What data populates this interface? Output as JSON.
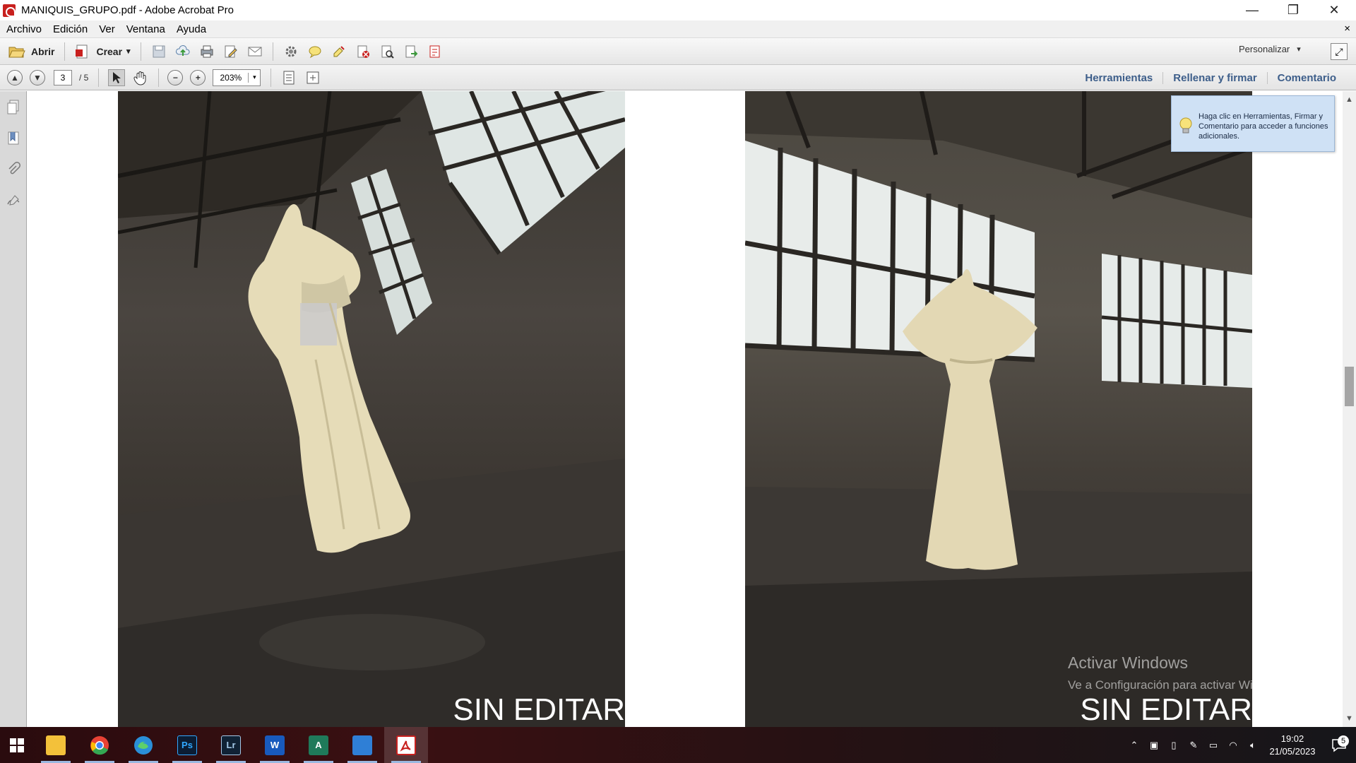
{
  "window": {
    "title": "MANIQUIS_GRUPO.pdf - Adobe Acrobat Pro",
    "minimize_glyph": "—",
    "restore_glyph": "❐",
    "close_glyph": "✕"
  },
  "menubar": {
    "items": [
      "Archivo",
      "Edición",
      "Ver",
      "Ventana",
      "Ayuda"
    ],
    "close_glyph": "×"
  },
  "toolbar": {
    "open_label": "Abrir",
    "create_label": "Crear",
    "customize_label": "Personalizar",
    "dropdown_glyph": "▾"
  },
  "navigation": {
    "current_page": "3",
    "total_pages": "/ 5",
    "zoom": "203%",
    "zoom_arrow": "▾"
  },
  "panels": {
    "tools": "Herramientas",
    "fill_sign": "Rellenar y firmar",
    "comment": "Comentario"
  },
  "tooltip": {
    "text": "Haga clic en Herramientas, Firmar y Comentario para acceder a funciones adicionales."
  },
  "document": {
    "left_caption": "SIN EDITAR",
    "right_caption": "SIN EDITAR"
  },
  "watermark": {
    "title": "Activar Windows",
    "subtitle": "Ve a Configuración para activar Windows."
  },
  "taskbar": {
    "apps": [
      {
        "name": "file-explorer",
        "label": "",
        "color": "#f3c13a"
      },
      {
        "name": "chrome",
        "label": "",
        "color": "#e94235"
      },
      {
        "name": "edge",
        "label": "",
        "color": "#2a8fd8"
      },
      {
        "name": "photoshop",
        "label": "Ps",
        "color": "#0b1d34"
      },
      {
        "name": "lightroom",
        "label": "Lr",
        "color": "#102235"
      },
      {
        "name": "word",
        "label": "W",
        "color": "#185abd"
      },
      {
        "name": "access",
        "label": "A",
        "color": "#1f7a5a"
      },
      {
        "name": "photos",
        "label": "",
        "color": "#2f7fd6"
      },
      {
        "name": "acrobat",
        "label": "",
        "color": "#c8201e"
      }
    ],
    "time": "19:02",
    "date": "21/05/2023",
    "notifications": "5"
  }
}
